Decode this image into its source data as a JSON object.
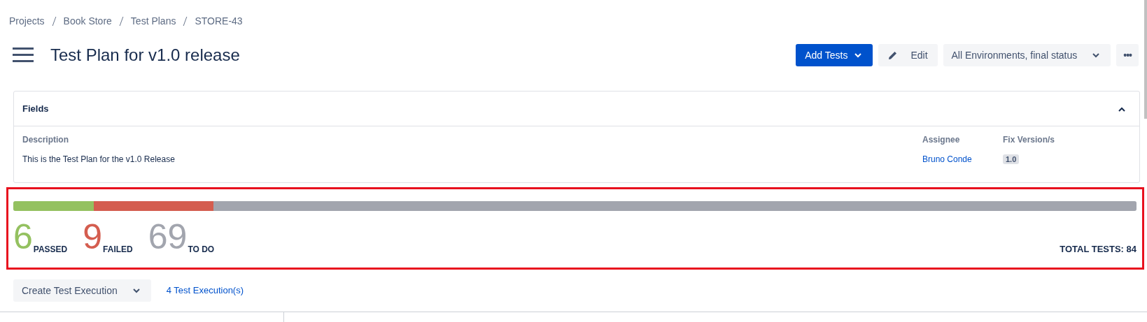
{
  "breadcrumbs": [
    "Projects",
    "Book Store",
    "Test Plans",
    "STORE-43"
  ],
  "title": "Test Plan for v1.0 release",
  "actions": [
    {
      "kind": "primary",
      "label": "Add Tests",
      "caret": true
    },
    {
      "kind": "edit",
      "label": "Edit",
      "caret": false
    },
    {
      "kind": "select",
      "label": "All Environments, final status",
      "caret": true
    },
    {
      "kind": "more",
      "label": "•••",
      "caret": false
    }
  ],
  "fields": {
    "title": "Fields",
    "expanded": true,
    "description": {
      "label": "Description",
      "value": "This is the Test Plan for the v1.0 Release"
    },
    "assignee": {
      "label": "Assignee",
      "value": "Bruno Conde"
    },
    "fix_versions": {
      "label": "Fix Version/s",
      "value": "1.0"
    }
  },
  "progress": {
    "highlighted": true,
    "segments": [
      {
        "count": "6",
        "label": "PASSED",
        "level": 0.0714,
        "color": "#94c160"
      },
      {
        "count": "9",
        "label": "FAILED",
        "level": 0.1071,
        "color": "#d45d4f"
      },
      {
        "count": "69",
        "label": "TO DO",
        "level": 0.8215,
        "color": "#a2a5ae"
      }
    ],
    "total": "TOTAL TESTS: 84"
  },
  "create_execution": "Create Test Execution",
  "executions_link": "4 Test Execution(s)"
}
